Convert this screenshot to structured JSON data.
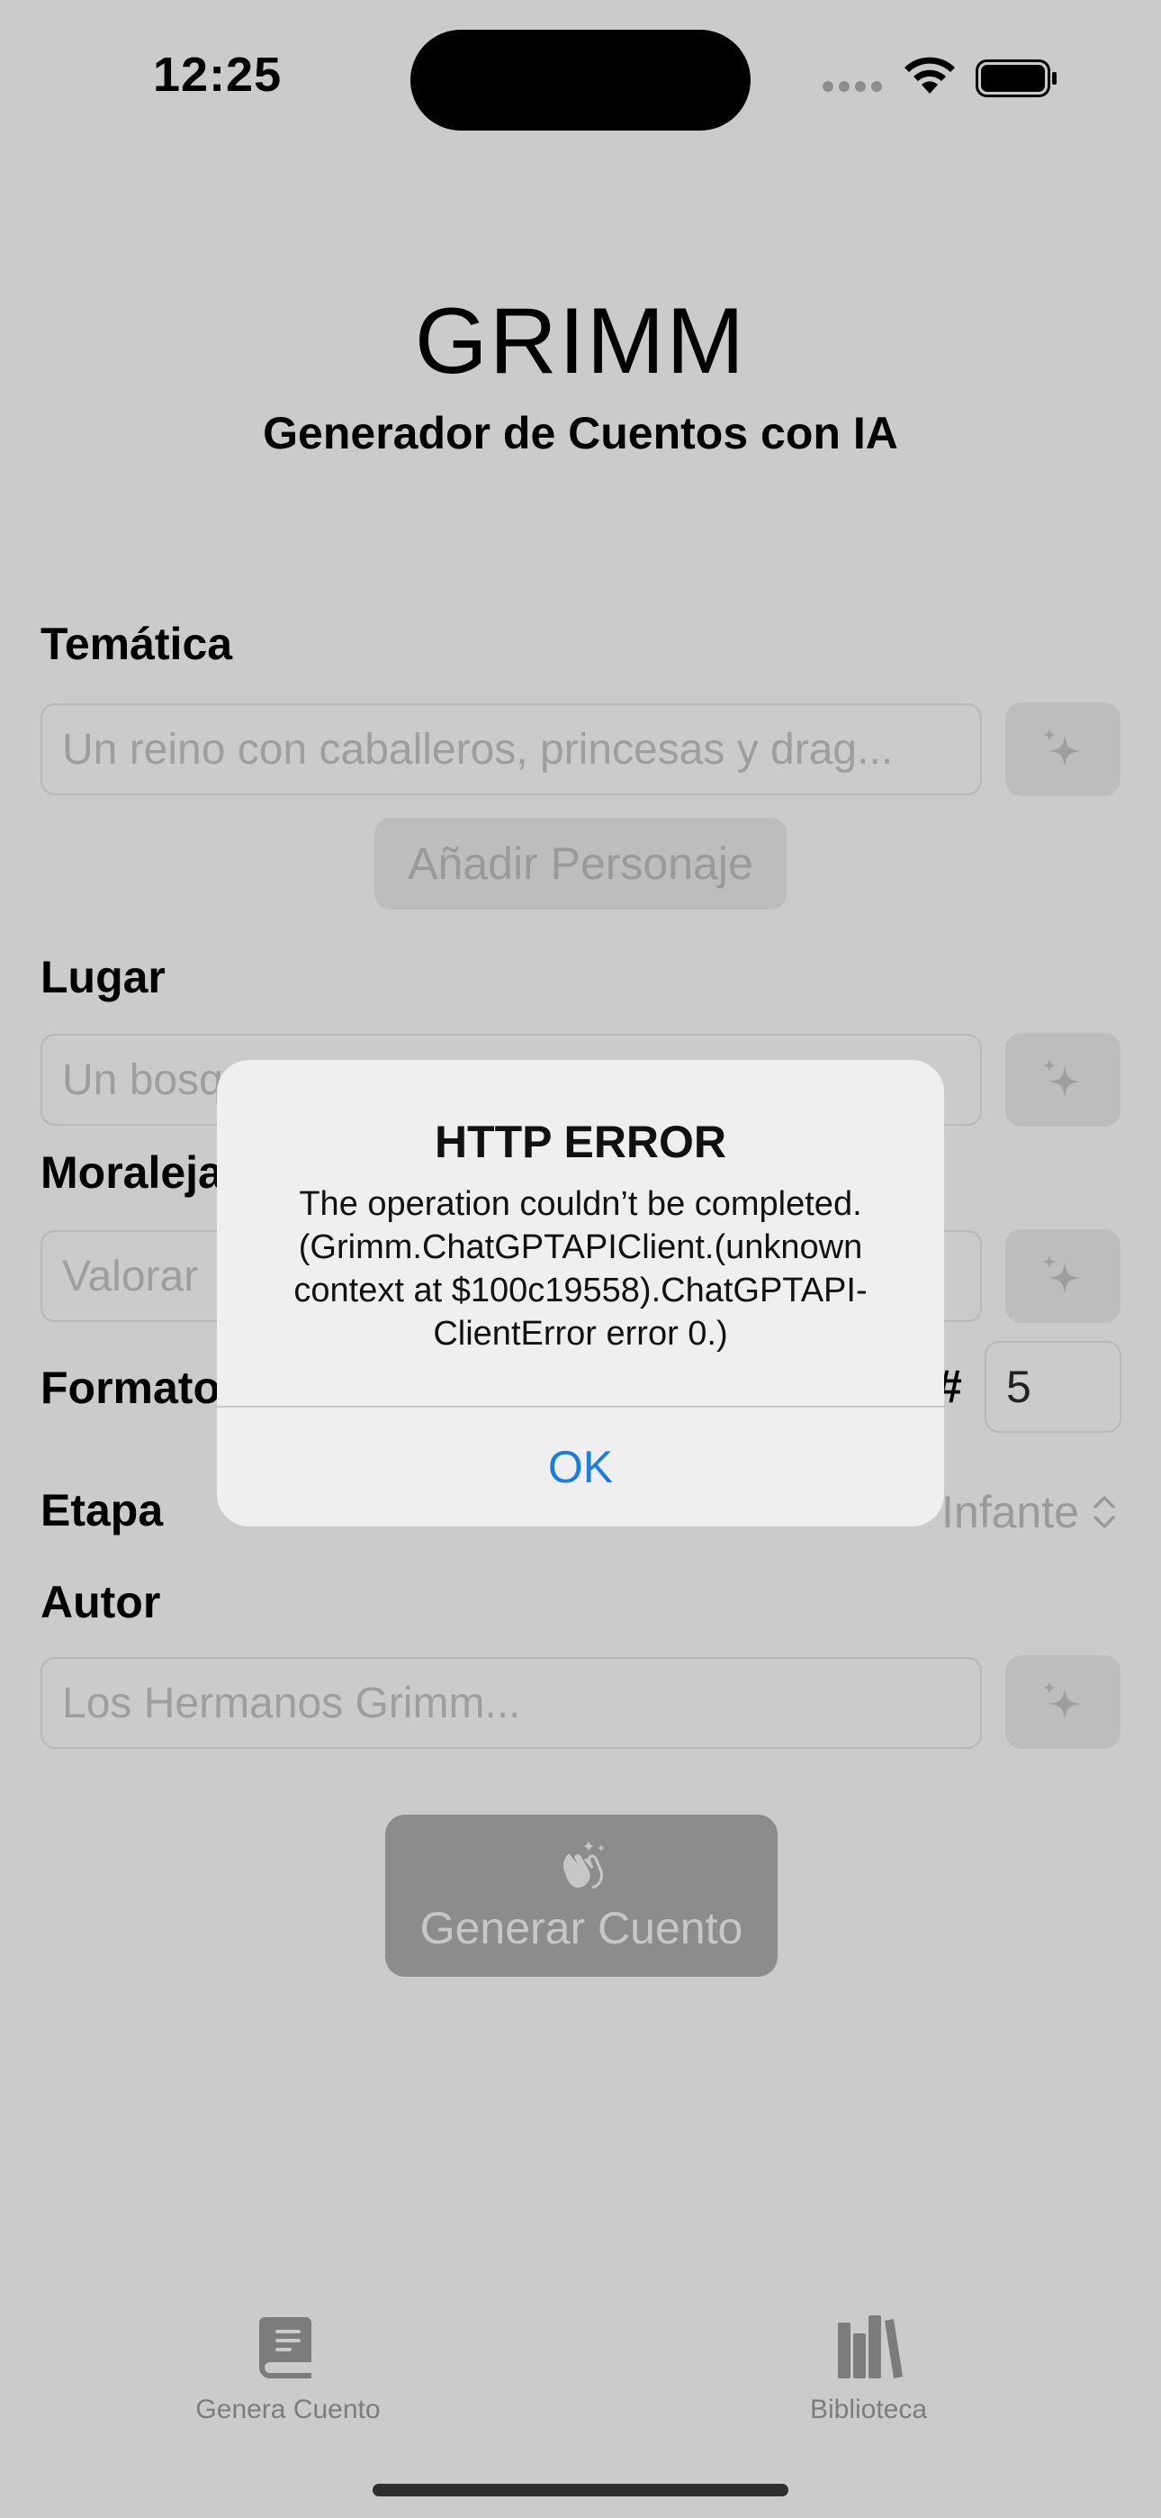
{
  "status_bar": {
    "time": "12:25"
  },
  "header": {
    "title": "GRIMM",
    "subtitle": "Generador de Cuentos con IA"
  },
  "form": {
    "tematica": {
      "label": "Temática",
      "placeholder": "Un reino con caballeros, princesas y drag..."
    },
    "add_character_label": "Añadir Personaje",
    "lugar": {
      "label": "Lugar",
      "placeholder": "Un bosque"
    },
    "moraleja": {
      "label": "Moraleja",
      "placeholder": "Valorar"
    },
    "formato": {
      "label": "Formato",
      "count_label": "#",
      "count_value": "5"
    },
    "etapa": {
      "label": "Etapa",
      "value": "Infante"
    },
    "autor": {
      "label": "Autor",
      "placeholder": "Los Hermanos Grimm..."
    },
    "generate_label": "Generar Cuento"
  },
  "tabs": [
    {
      "label": "Genera Cuento",
      "icon": "book-icon"
    },
    {
      "label": "Biblioteca",
      "icon": "books-vertical-icon"
    }
  ],
  "alert": {
    "title": "HTTP ERROR",
    "message_lines": [
      "The operation couldn’t be completed.",
      "(Grimm.ChatGPTAPIClient.(unknown",
      "context at $100c19558).ChatGPTAPI-",
      "ClientError error 0.)"
    ],
    "ok_label": "OK"
  },
  "colors": {
    "accent": "#1a7ee0",
    "dim_background": "#cbcbcb",
    "alert_background": "#efefef"
  }
}
